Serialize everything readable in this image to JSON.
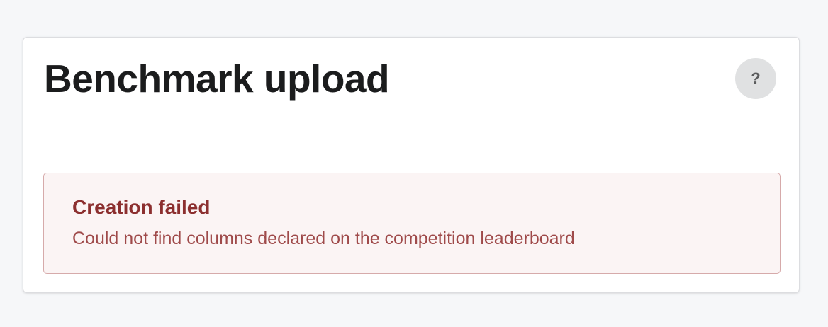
{
  "card": {
    "title": "Benchmark upload",
    "help_button_label": "?"
  },
  "error_message": {
    "header": "Creation failed",
    "text": "Could not find columns declared on the competition leaderboard"
  },
  "colors": {
    "page_background": "#f6f7f9",
    "card_background": "#ffffff",
    "title_text": "#1b1c1d",
    "help_button_background": "#e0e1e2",
    "error_background": "#fbf4f4",
    "error_border": "#d6aaaa",
    "error_header": "#8c2f2f",
    "error_text": "#9f4a4a"
  },
  "icons": {
    "help": "question-mark-icon"
  }
}
